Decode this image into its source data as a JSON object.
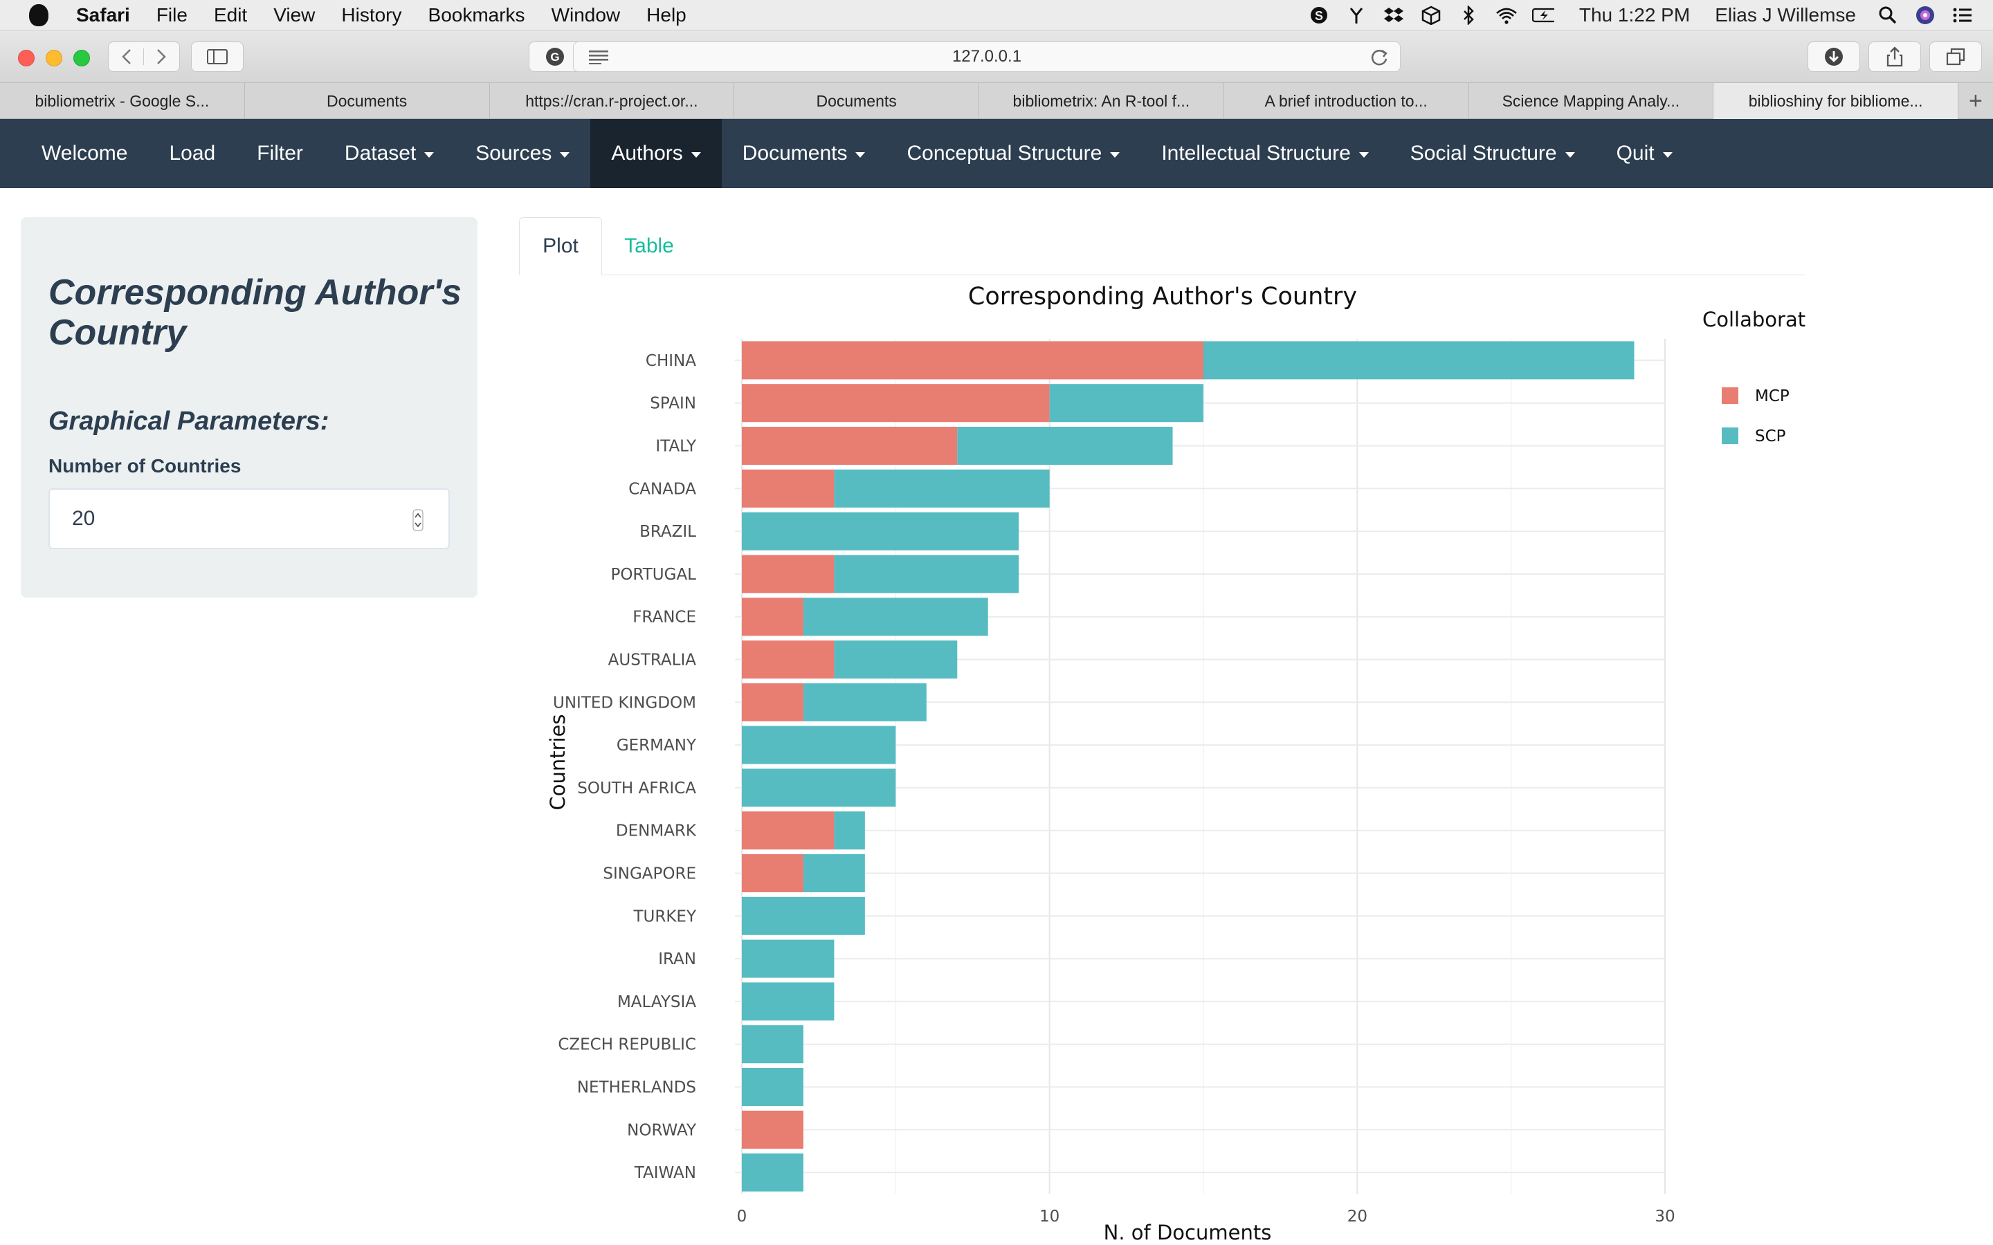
{
  "os_menubar": {
    "app": "Safari",
    "items": [
      "File",
      "Edit",
      "View",
      "History",
      "Bookmarks",
      "Window",
      "Help"
    ],
    "clock": "Thu 1:22 PM",
    "user": "Elias J Willemse"
  },
  "browser": {
    "url": "127.0.0.1",
    "tabs": [
      {
        "title": "bibliometrix - Google S...",
        "active": false
      },
      {
        "title": "Documents",
        "active": false
      },
      {
        "title": "https://cran.r-project.or...",
        "active": false
      },
      {
        "title": "Documents",
        "active": false
      },
      {
        "title": "bibliometrix: An R-tool f...",
        "active": false
      },
      {
        "title": "A brief introduction to...",
        "active": false
      },
      {
        "title": "Science Mapping Analy...",
        "active": false
      },
      {
        "title": "biblioshiny for bibliome...",
        "active": true
      }
    ],
    "new_tab": "+"
  },
  "navbar": {
    "items": [
      {
        "label": "Welcome",
        "dropdown": false,
        "active": false
      },
      {
        "label": "Load",
        "dropdown": false,
        "active": false
      },
      {
        "label": "Filter",
        "dropdown": false,
        "active": false
      },
      {
        "label": "Dataset",
        "dropdown": true,
        "active": false
      },
      {
        "label": "Sources",
        "dropdown": true,
        "active": false
      },
      {
        "label": "Authors",
        "dropdown": true,
        "active": true
      },
      {
        "label": "Documents",
        "dropdown": true,
        "active": false
      },
      {
        "label": "Conceptual Structure",
        "dropdown": true,
        "active": false
      },
      {
        "label": "Intellectual Structure",
        "dropdown": true,
        "active": false
      },
      {
        "label": "Social Structure",
        "dropdown": true,
        "active": false
      },
      {
        "label": "Quit",
        "dropdown": true,
        "active": false
      }
    ]
  },
  "sidebar": {
    "title": "Corresponding Author's Country",
    "subtitle": "Graphical Parameters:",
    "input_label": "Number of Countries",
    "input_value": "20"
  },
  "main_tabs": {
    "plot": "Plot",
    "table": "Table"
  },
  "colors": {
    "navbar": "#2c3e50",
    "navbar_active": "#1a242f",
    "mcp": "#e87d72",
    "scp": "#56bcc2",
    "tab_link": "#18bc9c"
  },
  "chart_data": {
    "type": "bar",
    "orientation": "horizontal",
    "stacked": true,
    "title": "Corresponding Author's Country",
    "xlabel": "N. of Documents",
    "ylabel": "Countries",
    "legend_title": "Collaborat",
    "legend_position": "right",
    "xlim": [
      0,
      30
    ],
    "xticks": [
      0,
      10,
      20,
      30
    ],
    "grid": true,
    "categories": [
      "CHINA",
      "SPAIN",
      "ITALY",
      "CANADA",
      "BRAZIL",
      "PORTUGAL",
      "FRANCE",
      "AUSTRALIA",
      "UNITED KINGDOM",
      "GERMANY",
      "SOUTH AFRICA",
      "DENMARK",
      "SINGAPORE",
      "TURKEY",
      "IRAN",
      "MALAYSIA",
      "CZECH REPUBLIC",
      "NETHERLANDS",
      "NORWAY",
      "TAIWAN"
    ],
    "series": [
      {
        "name": "MCP",
        "color": "#e87d72",
        "values": [
          15,
          10,
          7,
          3,
          0,
          3,
          2,
          3,
          2,
          0,
          0,
          3,
          2,
          0,
          0,
          0,
          0,
          0,
          2,
          0
        ]
      },
      {
        "name": "SCP",
        "color": "#56bcc2",
        "values": [
          14,
          5,
          7,
          7,
          9,
          6,
          6,
          4,
          4,
          5,
          5,
          1,
          2,
          4,
          3,
          3,
          2,
          2,
          0,
          2
        ]
      }
    ]
  }
}
